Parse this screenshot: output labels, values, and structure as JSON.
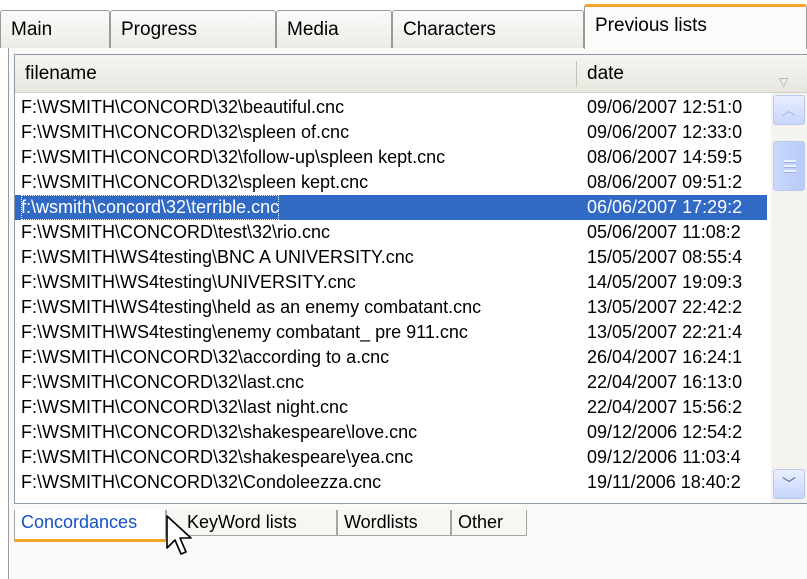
{
  "top_tabs": [
    {
      "label": "Main"
    },
    {
      "label": "Progress"
    },
    {
      "label": "Media"
    },
    {
      "label": "Characters"
    },
    {
      "label": "Previous lists"
    }
  ],
  "active_top_tab": "Previous lists",
  "columns": {
    "filename": "filename",
    "date": "date"
  },
  "rows": [
    {
      "file": "F:\\WSMITH\\CONCORD\\32\\beautiful.cnc",
      "date": "09/06/2007 12:51:0"
    },
    {
      "file": "F:\\WSMITH\\CONCORD\\32\\spleen of.cnc",
      "date": "09/06/2007 12:33:0"
    },
    {
      "file": "F:\\WSMITH\\CONCORD\\32\\follow-up\\spleen kept.cnc",
      "date": "08/06/2007 14:59:5"
    },
    {
      "file": "F:\\WSMITH\\CONCORD\\32\\spleen kept.cnc",
      "date": "08/06/2007 09:51:2"
    },
    {
      "file": "f:\\wsmith\\concord\\32\\terrible.cnc",
      "date": "06/06/2007 17:29:2",
      "selected": true
    },
    {
      "file": "F:\\WSMITH\\CONCORD\\test\\32\\rio.cnc",
      "date": "05/06/2007 11:08:2"
    },
    {
      "file": "F:\\WSMITH\\WS4testing\\BNC A UNIVERSITY.cnc",
      "date": "15/05/2007 08:55:4"
    },
    {
      "file": "F:\\WSMITH\\WS4testing\\UNIVERSITY.cnc",
      "date": "14/05/2007 19:09:3"
    },
    {
      "file": "F:\\WSMITH\\WS4testing\\held as an enemy combatant.cnc",
      "date": "13/05/2007 22:42:2"
    },
    {
      "file": "F:\\WSMITH\\WS4testing\\enemy combatant_ pre 911.cnc",
      "date": "13/05/2007 22:21:4"
    },
    {
      "file": "F:\\WSMITH\\CONCORD\\32\\according to a.cnc",
      "date": "26/04/2007 16:24:1"
    },
    {
      "file": "F:\\WSMITH\\CONCORD\\32\\last.cnc",
      "date": "22/04/2007 16:13:0"
    },
    {
      "file": "F:\\WSMITH\\CONCORD\\32\\last night.cnc",
      "date": "22/04/2007 15:56:2"
    },
    {
      "file": "F:\\WSMITH\\CONCORD\\32\\shakespeare\\love.cnc",
      "date": "09/12/2006 12:54:2"
    },
    {
      "file": "F:\\WSMITH\\CONCORD\\32\\shakespeare\\yea.cnc",
      "date": "09/12/2006 11:03:4"
    },
    {
      "file": "F:\\WSMITH\\CONCORD\\32\\Condoleezza.cnc",
      "date": "19/11/2006 18:40:2"
    }
  ],
  "bottom_tabs": [
    {
      "label": "Concordances"
    },
    {
      "label": "KeyWord lists"
    },
    {
      "label": "Wordlists"
    },
    {
      "label": "Other"
    }
  ],
  "active_bottom_tab": "Concordances",
  "colors": {
    "accent": "#f5a52a",
    "selection": "#316ac5",
    "link": "#1451c5"
  }
}
